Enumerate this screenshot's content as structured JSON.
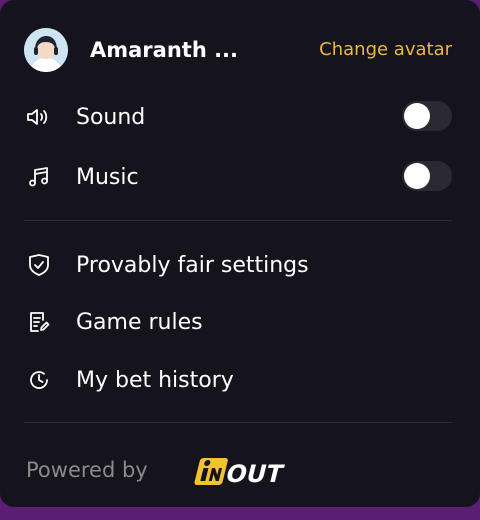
{
  "profile": {
    "username": "Amaranth ...",
    "change_avatar_label": "Change avatar",
    "avatar_icon": "user-avatar"
  },
  "settings": [
    {
      "label": "Sound",
      "icon": "speaker-icon",
      "enabled": false
    },
    {
      "label": "Music",
      "icon": "music-note-icon",
      "enabled": false
    }
  ],
  "menu": [
    {
      "label": "Provably fair settings",
      "icon": "shield-check-icon"
    },
    {
      "label": "Game rules",
      "icon": "document-edit-icon"
    },
    {
      "label": "My bet history",
      "icon": "history-clock-icon"
    }
  ],
  "footer": {
    "powered_by": "Powered by",
    "brand": "INOUT"
  },
  "colors": {
    "panel_bg": "#15141c",
    "accent": "#e7b84a",
    "text": "#ffffff",
    "muted": "#8a8990",
    "toggle_off": "#2b2a33"
  }
}
